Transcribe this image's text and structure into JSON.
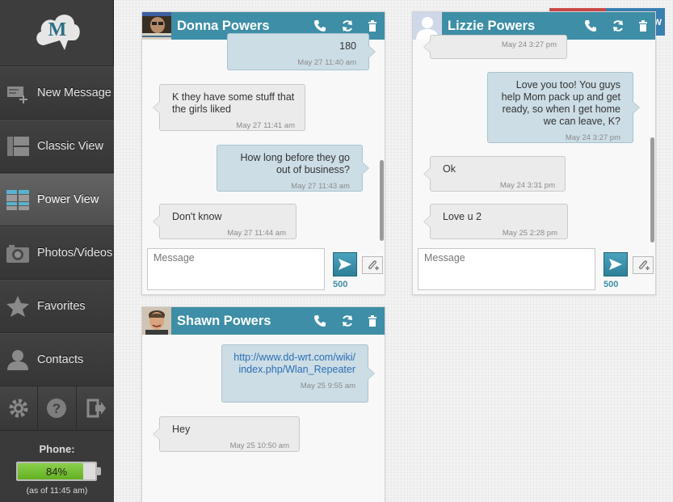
{
  "sidebar": {
    "logo_letter": "M",
    "items": [
      {
        "label": "New Message",
        "icon": "new-message-icon"
      },
      {
        "label": "Classic View",
        "icon": "classic-view-icon"
      },
      {
        "label": "Power View",
        "icon": "power-view-icon",
        "active": true
      },
      {
        "label": "Photos/Videos",
        "icon": "camera-icon"
      },
      {
        "label": "Favorites",
        "icon": "star-icon"
      },
      {
        "label": "Contacts",
        "icon": "person-icon"
      }
    ],
    "utility": [
      "gear-icon",
      "help-icon",
      "logout-icon"
    ],
    "help_glyph": "?"
  },
  "phone": {
    "label": "Phone:",
    "battery_text": "84%",
    "battery_level": 0.84,
    "as_of": "(as of 11:45 am)"
  },
  "background_button_fragment": "W",
  "colors": {
    "header_teal": "#3d8ea6",
    "sidebar_dark": "#3a3a3a",
    "outgoing_bubble": "#ccdde5",
    "incoming_bubble": "#ebebeb",
    "battery_green": "#6abb2c"
  },
  "conversations": [
    {
      "name": "Donna Powers",
      "input_placeholder": "Message",
      "char_count": "500",
      "messages": [
        {
          "dir": "out",
          "text": "180",
          "time": "May 27 11:40 am"
        },
        {
          "dir": "in",
          "text": "K they have some stuff that the girls liked",
          "time": "May 27 11:41 am"
        },
        {
          "dir": "out",
          "text": "How long before they go out of business?",
          "time": "May 27 11:43 am"
        },
        {
          "dir": "in",
          "text": "Don't know",
          "time": "May 27 11:44 am"
        }
      ]
    },
    {
      "name": "Lizzie Powers",
      "input_placeholder": "Message",
      "char_count": "500",
      "messages": [
        {
          "dir": "in",
          "text": "",
          "time": "May 24 3:27 pm"
        },
        {
          "dir": "out",
          "text": "Love you too! You guys help Mom pack up and get ready, so when I get home we can leave, K?",
          "time": "May 24 3:27 pm"
        },
        {
          "dir": "in",
          "text": "Ok",
          "time": "May 24 3:31 pm"
        },
        {
          "dir": "in",
          "text": "Love u 2",
          "time": "May 25 2:28 pm"
        }
      ]
    },
    {
      "name": "Shawn Powers",
      "messages": [
        {
          "dir": "out",
          "text": "http://www.dd-wrt.com/wiki/index.php/Wlan_Repeater",
          "time": "May 25 9:55 am"
        },
        {
          "dir": "in",
          "text": "Hey",
          "time": "May 25 10:50 am"
        }
      ]
    }
  ]
}
